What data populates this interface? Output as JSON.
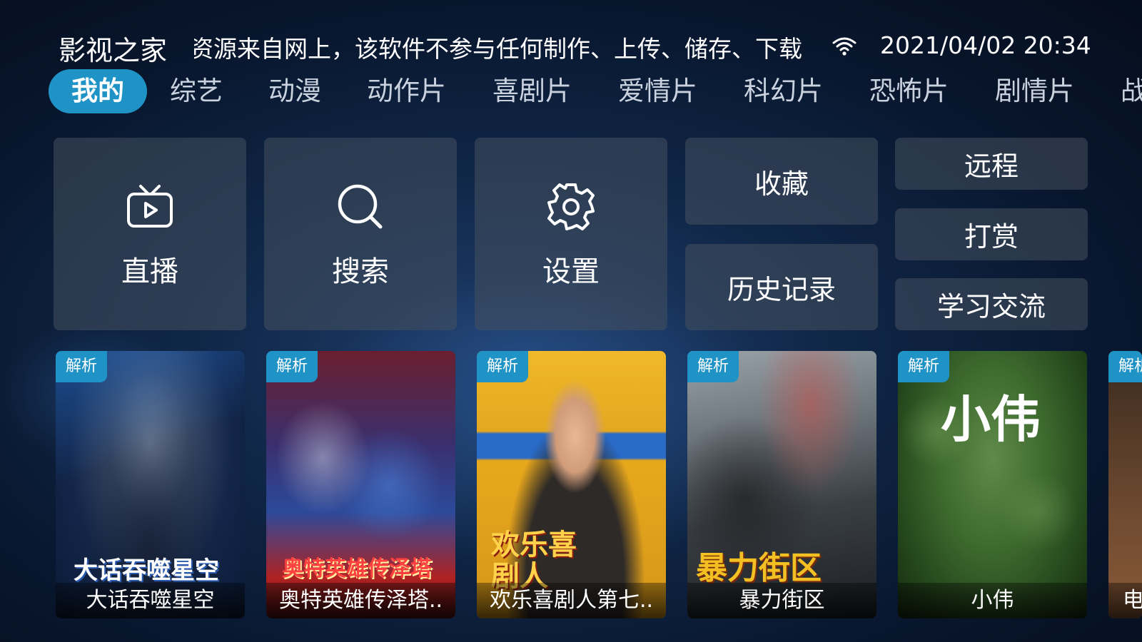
{
  "header": {
    "app_title": "影视之家",
    "notice": "资源来自网上，该软件不参与任何制作、上传、储存、下载",
    "wifi_icon": "wifi-icon",
    "datetime": "2021/04/02 20:34"
  },
  "tabs": [
    {
      "label": "我的",
      "active": true
    },
    {
      "label": "综艺"
    },
    {
      "label": "动漫"
    },
    {
      "label": "动作片"
    },
    {
      "label": "喜剧片"
    },
    {
      "label": "爱情片"
    },
    {
      "label": "科幻片"
    },
    {
      "label": "恐怖片"
    },
    {
      "label": "剧情片"
    },
    {
      "label": "战"
    }
  ],
  "functions": {
    "live": {
      "label": "直播",
      "icon": "tv-play-icon"
    },
    "search": {
      "label": "搜索",
      "icon": "search-icon"
    },
    "settings": {
      "label": "设置",
      "icon": "gear-icon"
    },
    "favorites": "收藏",
    "history": "历史记录",
    "remote": "远程",
    "tip": "打赏",
    "community": "学习交流"
  },
  "cards": [
    {
      "badge": "解析",
      "title": "大话吞噬星空",
      "poster_text": "大话吞噬星空"
    },
    {
      "badge": "解析",
      "title": "奥特英雄传泽塔..",
      "poster_text": "奥特英雄传泽塔"
    },
    {
      "badge": "解析",
      "title": "欢乐喜剧人第七..",
      "poster_text": "欢乐喜剧人"
    },
    {
      "badge": "解析",
      "title": "暴力街区",
      "poster_text": "暴力街区"
    },
    {
      "badge": "解析",
      "title": "小伟",
      "poster_text": "小伟"
    },
    {
      "badge": "解析",
      "title": "电"
    }
  ],
  "colors": {
    "accent": "#1f93c6",
    "tile_bg": "#46505f"
  }
}
